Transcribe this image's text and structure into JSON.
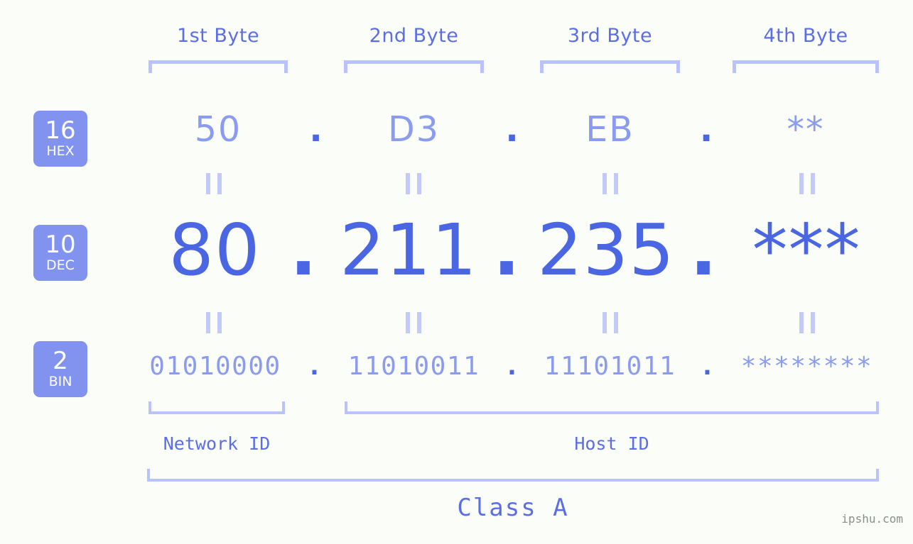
{
  "canvas": {
    "background": "#fbfdf8",
    "accent_strong": "#4a66e3",
    "accent_light": "#8b9bf0",
    "accent_bracket": "#b9c2fb",
    "badge_bg": "#8193ef",
    "label_color": "#5b6ee8"
  },
  "byte_headers": [
    {
      "label": "1st Byte"
    },
    {
      "label": "2nd Byte"
    },
    {
      "label": "3rd Byte"
    },
    {
      "label": "4th Byte"
    }
  ],
  "bases": [
    {
      "num": "16",
      "name": "HEX"
    },
    {
      "num": "10",
      "name": "DEC"
    },
    {
      "num": "2",
      "name": "BIN"
    }
  ],
  "rows": {
    "hex": {
      "base_num": "16",
      "base_name": "HEX",
      "values": [
        "50",
        "D3",
        "EB",
        "**"
      ],
      "separator": "."
    },
    "dec": {
      "base_num": "10",
      "base_name": "DEC",
      "values": [
        "80",
        "211",
        "235",
        "***"
      ],
      "separator": "."
    },
    "bin": {
      "base_num": "2",
      "base_name": "BIN",
      "values": [
        "01010000",
        "11010011",
        "11101011",
        "********"
      ],
      "separator": "."
    }
  },
  "equals_markers": {
    "glyph": "||",
    "count_top": 4,
    "count_bottom": 4
  },
  "groups": [
    {
      "label": "Network ID"
    },
    {
      "label": "Host ID"
    }
  ],
  "class": {
    "label": "Class A"
  },
  "watermark": {
    "text": "ipshu.com"
  },
  "ip_summary": {
    "dec_address": "80.211.235.***",
    "hex_address": "50.D3.EB.**",
    "bin_address": "01010000.11010011.11101011.********",
    "network_id_bytes": 1,
    "host_id_bytes": 3,
    "class": "Class A"
  }
}
